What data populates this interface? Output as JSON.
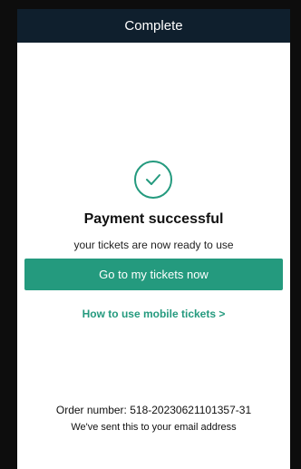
{
  "header": {
    "title": "Complete"
  },
  "status": {
    "icon": "check-circle-icon",
    "headline": "Payment successful",
    "subline": "your tickets are now ready to use"
  },
  "actions": {
    "primary_label": "Go to my tickets now",
    "help_link": "How to use mobile tickets >"
  },
  "order": {
    "number_text": "Order number: 518-20230621101357-31",
    "email_note": "We've sent this to your email address"
  },
  "colors": {
    "accent": "#249a7e",
    "header_bg": "#0f1f2d",
    "frame": "#0d0d0d"
  }
}
